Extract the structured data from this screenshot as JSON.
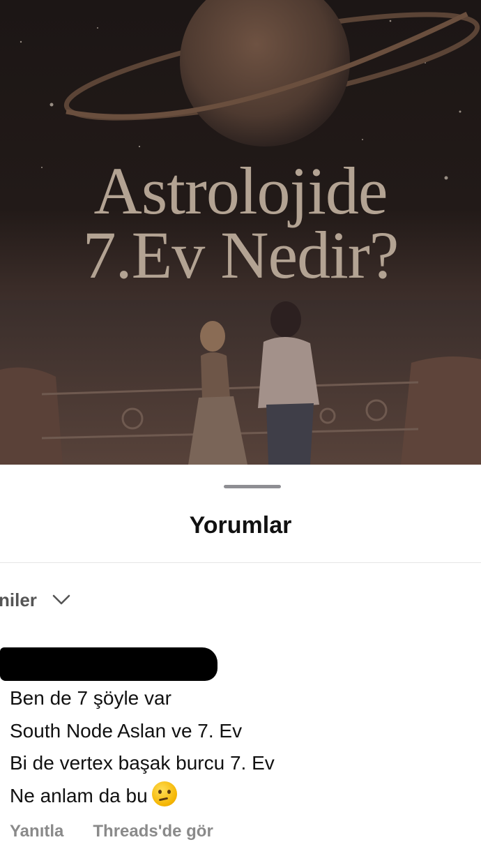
{
  "post": {
    "title_line1": "Astrolojide",
    "title_line2": "7.Ev Nedir?"
  },
  "comments_sheet": {
    "title": "Yorumlar",
    "sort_label": "niler",
    "sort_icon": "chevron-down-icon"
  },
  "comment": {
    "lines": [
      "Ben de 7 şöyle var",
      "South Node Aslan ve 7. Ev",
      "Bi de vertex başak burcu 7. Ev",
      "Ne anlam da bu"
    ],
    "emoji": "thinking-face-emoji",
    "reply_label": "Yanıtla",
    "threads_label": "Threads'de gör"
  }
}
